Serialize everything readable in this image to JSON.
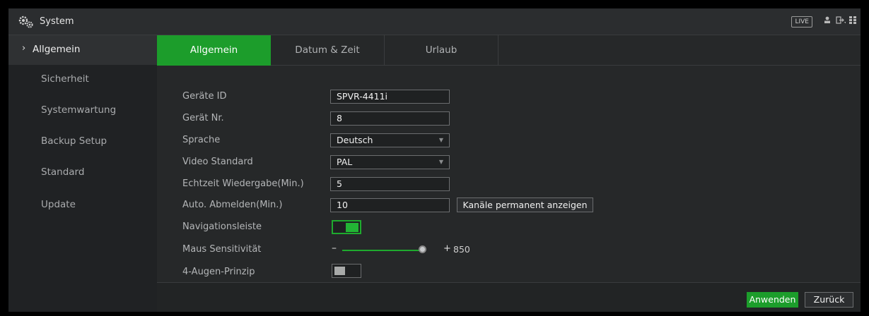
{
  "window": {
    "title": "System",
    "live_badge": "LIVE"
  },
  "titlebar_icons": [
    "user-icon",
    "logout-icon",
    "grid-menu-icon"
  ],
  "sidebar": {
    "items": [
      {
        "label": "Allgemein",
        "active": true
      },
      {
        "label": "Sicherheit"
      },
      {
        "label": "Systemwartung"
      },
      {
        "label": "Backup Setup"
      },
      {
        "label": "Standard"
      },
      {
        "label": "Update"
      }
    ]
  },
  "tabs": [
    {
      "label": "Allgemein",
      "active": true
    },
    {
      "label": "Datum & Zeit"
    },
    {
      "label": "Urlaub"
    }
  ],
  "form": {
    "device_id": {
      "label": "Geräte ID",
      "value": "SPVR-4411i"
    },
    "device_no": {
      "label": "Gerät Nr.",
      "value": "8"
    },
    "language": {
      "label": "Sprache",
      "value": "Deutsch"
    },
    "video_standard": {
      "label": "Video Standard",
      "value": "PAL"
    },
    "realtime_playback": {
      "label": "Echtzeit Wiedergabe(Min.)",
      "value": "5"
    },
    "auto_logout": {
      "label": "Auto. Abmelden(Min.)",
      "value": "10"
    },
    "show_channels_button": "Kanäle permanent anzeigen",
    "nav_bar": {
      "label": "Navigationsleiste",
      "enabled": true
    },
    "mouse_sensitivity": {
      "label": "Maus Sensitivität",
      "minus": "–",
      "plus": "+",
      "value": "850"
    },
    "four_eyes": {
      "label": "4-Augen-Prinzip",
      "enabled": false
    }
  },
  "footer": {
    "apply_label": "Anwenden",
    "back_label": "Zurück"
  },
  "colors": {
    "accent": "#1c9d2b",
    "background": "#262829"
  }
}
